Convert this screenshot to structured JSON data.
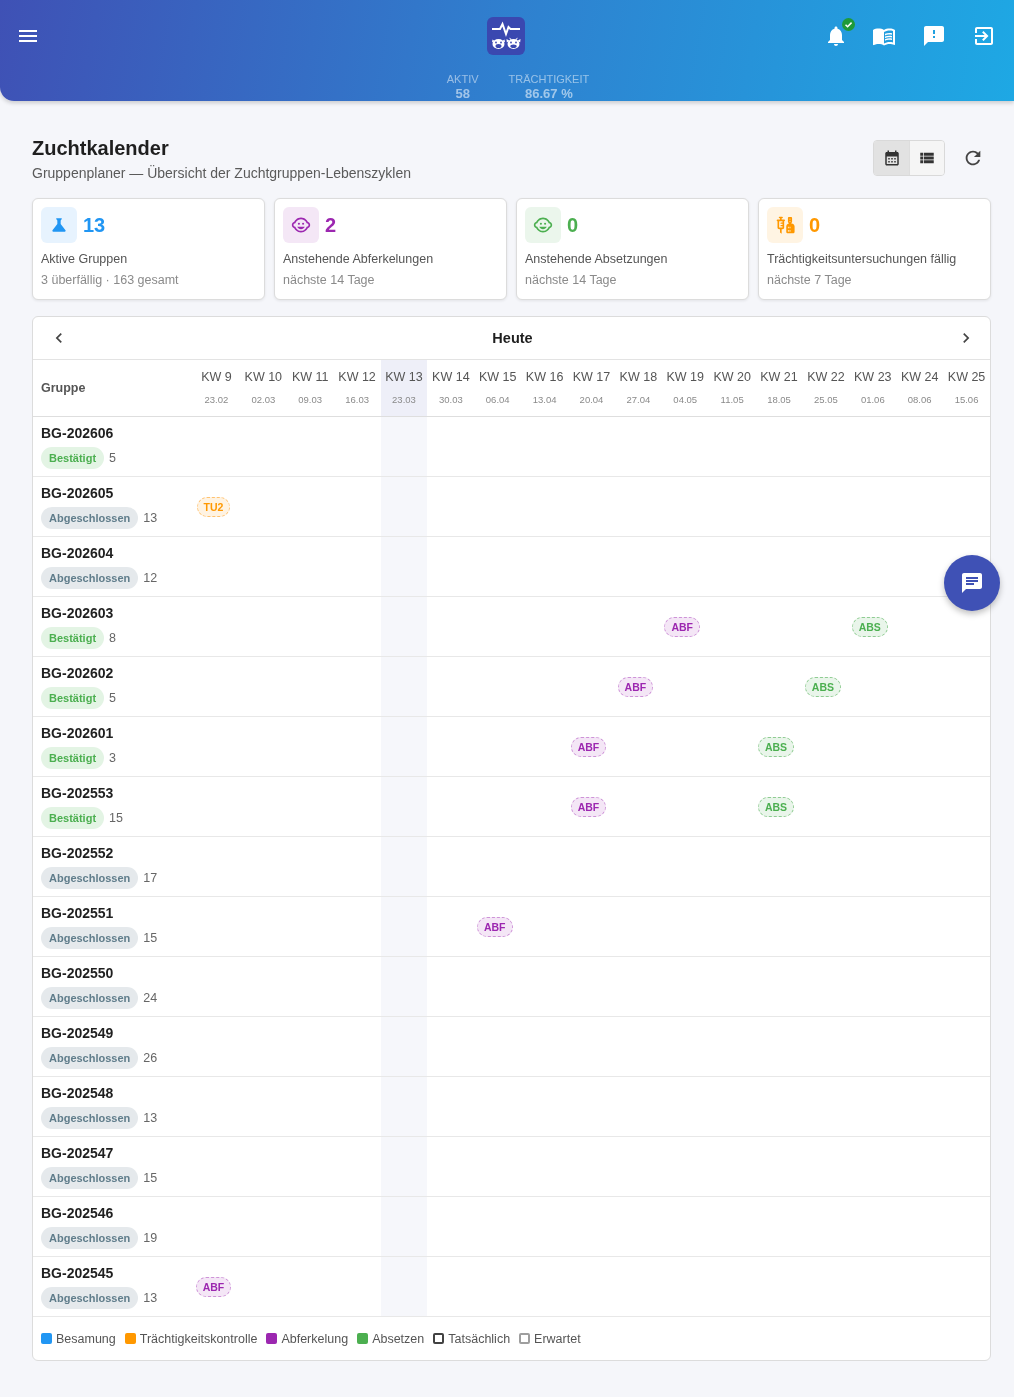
{
  "header": {
    "stats": [
      {
        "label": "AKTIV",
        "value": "58"
      },
      {
        "label": "TRÄCHTIGKEIT",
        "value": "86.67 %"
      }
    ]
  },
  "page": {
    "title": "Zuchtkalender",
    "subtitle": "Gruppenplaner — Übersicht der Zuchtgruppen-Lebenszyklen"
  },
  "view_toggle": [
    {
      "kind": "calendar",
      "selected": true
    },
    {
      "kind": "list",
      "selected": false
    }
  ],
  "stats": [
    {
      "kind": "groups",
      "color": "#2196f3",
      "value": "13",
      "label": "Aktive Gruppen",
      "note": "3 überfällig · 163 gesamt"
    },
    {
      "kind": "farrowing",
      "color": "#9c27b0",
      "value": "2",
      "label": "Anstehende Abferkelungen",
      "note": "nächste 14 Tage"
    },
    {
      "kind": "weaning",
      "color": "#4caf50",
      "value": "0",
      "label": "Anstehende Absetzungen",
      "note": "nächste 14 Tage"
    },
    {
      "kind": "pregnancy_check",
      "color": "#ff9800",
      "value": "0",
      "label": "Trächtigkeitsuntersuchungen fällig",
      "note": "nächste 7 Tage"
    }
  ],
  "calendar": {
    "today_label": "Heute",
    "group_heading": "Gruppe",
    "weeks": [
      {
        "label": "KW 9",
        "date": "23.02",
        "current": false
      },
      {
        "label": "KW 10",
        "date": "02.03",
        "current": false
      },
      {
        "label": "KW 11",
        "date": "09.03",
        "current": false
      },
      {
        "label": "KW 12",
        "date": "16.03",
        "current": false
      },
      {
        "label": "KW 13",
        "date": "23.03",
        "current": true
      },
      {
        "label": "KW 14",
        "date": "30.03",
        "current": false
      },
      {
        "label": "KW 15",
        "date": "06.04",
        "current": false
      },
      {
        "label": "KW 16",
        "date": "13.04",
        "current": false
      },
      {
        "label": "KW 17",
        "date": "20.04",
        "current": false
      },
      {
        "label": "KW 18",
        "date": "27.04",
        "current": false
      },
      {
        "label": "KW 19",
        "date": "04.05",
        "current": false
      },
      {
        "label": "KW 20",
        "date": "11.05",
        "current": false
      },
      {
        "label": "KW 21",
        "date": "18.05",
        "current": false
      },
      {
        "label": "KW 22",
        "date": "25.05",
        "current": false
      },
      {
        "label": "KW 23",
        "date": "01.06",
        "current": false
      },
      {
        "label": "KW 24",
        "date": "08.06",
        "current": false
      },
      {
        "label": "KW 25",
        "date": "15.06",
        "current": false
      }
    ],
    "rows": [
      {
        "name": "BG-202606",
        "status": {
          "label": "Bestätigt",
          "kind": "confirmed"
        },
        "count": "5"
      },
      {
        "name": "BG-202605",
        "status": {
          "label": "Abgeschlossen",
          "kind": "closed"
        },
        "count": "13",
        "cells": [
          {
            "label": "TU2",
            "kind": "pregnancy_check",
            "expected": true
          },
          null,
          null,
          null,
          null,
          null,
          null,
          null,
          null,
          null,
          null,
          null,
          null,
          null,
          null,
          null,
          null
        ]
      },
      {
        "name": "BG-202604",
        "status": {
          "label": "Abgeschlossen",
          "kind": "closed"
        },
        "count": "12"
      },
      {
        "name": "BG-202603",
        "status": {
          "label": "Bestätigt",
          "kind": "confirmed"
        },
        "count": "8",
        "cells": [
          null,
          null,
          null,
          null,
          null,
          null,
          null,
          null,
          null,
          null,
          {
            "label": "ABF",
            "kind": "farrowing",
            "expected": true
          },
          null,
          null,
          null,
          {
            "label": "ABS",
            "kind": "weaning",
            "expected": true
          },
          null,
          null
        ]
      },
      {
        "name": "BG-202602",
        "status": {
          "label": "Bestätigt",
          "kind": "confirmed"
        },
        "count": "5",
        "cells": [
          null,
          null,
          null,
          null,
          null,
          null,
          null,
          null,
          null,
          {
            "label": "ABF",
            "kind": "farrowing",
            "expected": true
          },
          null,
          null,
          null,
          {
            "label": "ABS",
            "kind": "weaning",
            "expected": true
          },
          null,
          null,
          null
        ]
      },
      {
        "name": "BG-202601",
        "status": {
          "label": "Bestätigt",
          "kind": "confirmed"
        },
        "count": "3",
        "cells": [
          null,
          null,
          null,
          null,
          null,
          null,
          null,
          null,
          {
            "label": "ABF",
            "kind": "farrowing",
            "expected": true
          },
          null,
          null,
          null,
          {
            "label": "ABS",
            "kind": "weaning",
            "expected": true
          },
          null,
          null,
          null,
          null
        ]
      },
      {
        "name": "BG-202553",
        "status": {
          "label": "Bestätigt",
          "kind": "confirmed"
        },
        "count": "15",
        "cells": [
          null,
          null,
          null,
          null,
          null,
          null,
          null,
          null,
          {
            "label": "ABF",
            "kind": "farrowing",
            "expected": true
          },
          null,
          null,
          null,
          {
            "label": "ABS",
            "kind": "weaning",
            "expected": true
          },
          null,
          null,
          null,
          null
        ]
      },
      {
        "name": "BG-202552",
        "status": {
          "label": "Abgeschlossen",
          "kind": "closed"
        },
        "count": "17"
      },
      {
        "name": "BG-202551",
        "status": {
          "label": "Abgeschlossen",
          "kind": "closed"
        },
        "count": "15",
        "cells": [
          null,
          null,
          null,
          null,
          null,
          null,
          {
            "label": "ABF",
            "kind": "farrowing",
            "expected": true
          },
          null,
          null,
          null,
          null,
          null,
          null,
          null,
          null,
          null,
          null
        ]
      },
      {
        "name": "BG-202550",
        "status": {
          "label": "Abgeschlossen",
          "kind": "closed"
        },
        "count": "24"
      },
      {
        "name": "BG-202549",
        "status": {
          "label": "Abgeschlossen",
          "kind": "closed"
        },
        "count": "26"
      },
      {
        "name": "BG-202548",
        "status": {
          "label": "Abgeschlossen",
          "kind": "closed"
        },
        "count": "13"
      },
      {
        "name": "BG-202547",
        "status": {
          "label": "Abgeschlossen",
          "kind": "closed"
        },
        "count": "15"
      },
      {
        "name": "BG-202546",
        "status": {
          "label": "Abgeschlossen",
          "kind": "closed"
        },
        "count": "19"
      },
      {
        "name": "BG-202545",
        "status": {
          "label": "Abgeschlossen",
          "kind": "closed"
        },
        "count": "13",
        "cells": [
          {
            "label": "ABF",
            "kind": "farrowing",
            "expected": true
          },
          null,
          null,
          null,
          null,
          null,
          null,
          null,
          null,
          null,
          null,
          null,
          null,
          null,
          null,
          null,
          null
        ]
      }
    ]
  },
  "legend": [
    {
      "label": "Besamung",
      "kind": "fill",
      "color": "#2196f3"
    },
    {
      "label": "Trächtigkeitskontrolle",
      "kind": "fill",
      "color": "#ff9800"
    },
    {
      "label": "Abferkelung",
      "kind": "fill",
      "color": "#9c27b0"
    },
    {
      "label": "Absetzen",
      "kind": "fill",
      "color": "#4caf50"
    },
    {
      "label": "Tatsächlich",
      "kind": "outline",
      "color": "#424242"
    },
    {
      "label": "Erwartet",
      "kind": "outline",
      "color": "#9e9e9e"
    }
  ]
}
